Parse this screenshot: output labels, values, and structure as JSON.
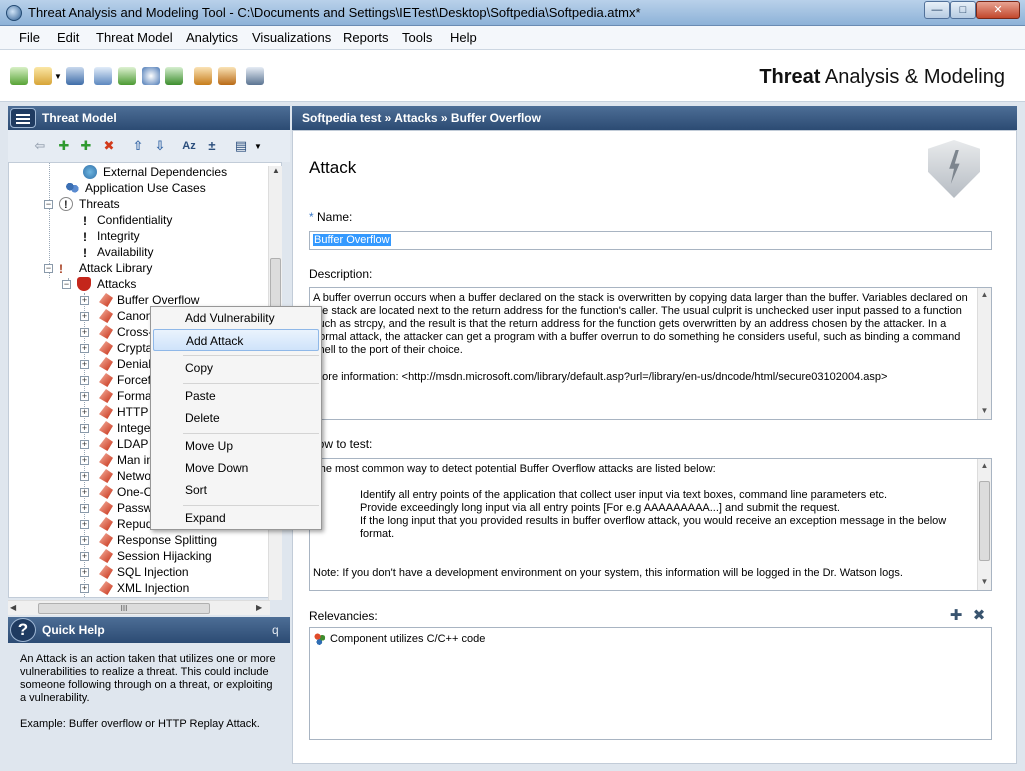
{
  "window": {
    "title": "Threat Analysis and Modeling Tool - C:\\Documents and Settings\\IETest\\Desktop\\Softpedia\\Softpedia.atmx*",
    "min_glyph": "—",
    "max_glyph": "□",
    "close_glyph": "✕"
  },
  "menu": {
    "file": "File",
    "edit": "Edit",
    "threat_model": "Threat Model",
    "analytics": "Analytics",
    "visualizations": "Visualizations",
    "reports": "Reports",
    "tools": "Tools",
    "help": "Help"
  },
  "brand": {
    "bold": "Threat",
    "rest": " Analysis & Modeling"
  },
  "left_panel": {
    "title": "Threat Model",
    "tree": [
      {
        "label": "External Dependencies"
      },
      {
        "label": "Application Use Cases"
      },
      {
        "label": "Threats"
      },
      {
        "label": "Confidentiality"
      },
      {
        "label": "Integrity"
      },
      {
        "label": "Availability"
      },
      {
        "label": "Attack Library"
      },
      {
        "label": "Attacks"
      },
      {
        "label": "Buffer Overflow"
      },
      {
        "label": "Canoni"
      },
      {
        "label": "Cross-S"
      },
      {
        "label": "Cryptar"
      },
      {
        "label": "Denial"
      },
      {
        "label": "Forcefu"
      },
      {
        "label": "Format"
      },
      {
        "label": "HTTP"
      },
      {
        "label": "Integer"
      },
      {
        "label": "LDAP I"
      },
      {
        "label": "Man in"
      },
      {
        "label": "Networ"
      },
      {
        "label": "One-Cli"
      },
      {
        "label": "Passwo"
      },
      {
        "label": "Repudi"
      },
      {
        "label": "Response Splitting"
      },
      {
        "label": "Session Hijacking"
      },
      {
        "label": "SQL Injection"
      },
      {
        "label": "XML Injection"
      }
    ],
    "hscroll_grip": "III"
  },
  "quick_help": {
    "title": "Quick Help",
    "pin": "q",
    "body": "An Attack is an action taken that utilizes one or more vulnerabilities to realize a threat. This could include someone following through on a threat, or exploiting a vulnerability.",
    "example": "Example: Buffer overflow or HTTP Replay Attack."
  },
  "breadcrumb": "Softpedia test » Attacks » Buffer Overflow",
  "detail": {
    "heading": "Attack",
    "required_mark": "*",
    "name_label": "Name:",
    "name_value": "Buffer Overflow",
    "description_label": "Description:",
    "description_text": "A buffer overrun occurs when a buffer declared on the stack is overwritten by copying data larger than the buffer. Variables declared on the stack are located next to the return address for the function's caller. The usual culprit is unchecked user input passed to a function such as strcpy, and the result is that the return address for the function gets overwritten by an address chosen by the attacker. In a normal attack, the attacker can get a program with a buffer overrun to do something he considers useful, such as binding a command shell to the port of their choice.",
    "description_more": "More information: <http://msdn.microsoft.com/library/default.asp?url=/library/en-us/dncode/html/secure03102004.asp>",
    "howto_label": "How to test:",
    "howto_intro": "The most common way to detect potential Buffer Overflow attacks are listed below:",
    "howto_steps": [
      "Identify all entry points of the application that collect user input via text boxes, command line parameters etc.",
      "Provide exceedingly long input via all entry points [For e.g AAAAAAAAA...] and submit the request.",
      "If the long input that you provided results in buffer overflow attack, you would receive an exception message in the below format."
    ],
    "howto_note": "Note: If you don't have a development environment on your system, this information will be logged in the Dr. Watson logs.",
    "relevancies_label": "Relevancies:",
    "relevancy_item": "Component utilizes C/C++ code"
  },
  "context_menu": {
    "add_vulnerability": "Add Vulnerability",
    "add_attack": "Add Attack",
    "copy": "Copy",
    "paste": "Paste",
    "delete": "Delete",
    "move_up": "Move Up",
    "move_down": "Move Down",
    "sort": "Sort",
    "expand": "Expand"
  }
}
